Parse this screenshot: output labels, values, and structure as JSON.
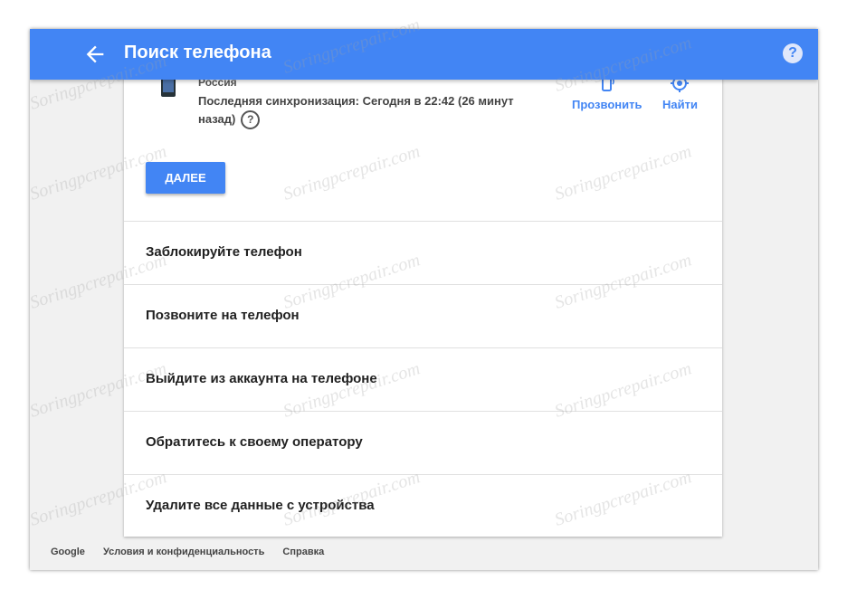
{
  "header": {
    "title": "Поиск телефона"
  },
  "device": {
    "country": "Россия",
    "sync_text": "Последняя синхронизация: Сегодня в 22:42 (26 минут назад)"
  },
  "actions": [
    {
      "label": "Прозвонить",
      "icon": "phone-ring-icon"
    },
    {
      "label": "Найти",
      "icon": "locate-icon"
    }
  ],
  "next_button": "ДАЛЕЕ",
  "options": [
    "Заблокируйте телефон",
    "Позвоните на телефон",
    "Выйдите из аккаунта на телефоне",
    "Обратитесь к своему оператору",
    "Удалите все данные с устройства"
  ],
  "footer": {
    "links": [
      "Google",
      "Условия и конфиденциальность",
      "Справка"
    ]
  },
  "watermark": "Soringpcrepair.com",
  "colors": {
    "accent": "#4285f4",
    "background": "#f1f1f1"
  }
}
